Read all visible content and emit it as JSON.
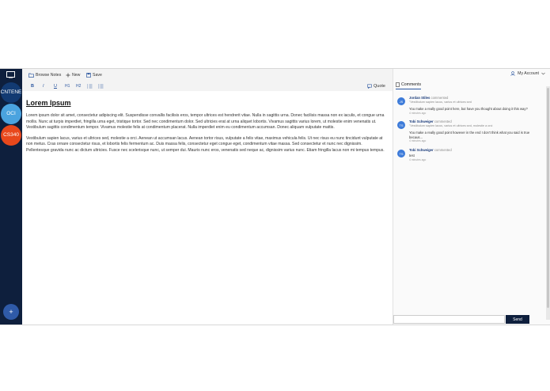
{
  "sidebar": {
    "courses": [
      {
        "label": "CNTENE",
        "color": "#123a72"
      },
      {
        "label": "OCI",
        "color": "#4aa3df"
      },
      {
        "label": "CS340",
        "color": "#e8481c"
      }
    ],
    "add_label": "+"
  },
  "toolbar": {
    "browse_notes": "Browse Notes",
    "new_label": "New",
    "save_label": "Save",
    "format": {
      "bold": "B",
      "italic": "I",
      "underline": "U",
      "h1": "H1",
      "h2": "H2"
    },
    "quote_label": "Quote"
  },
  "document": {
    "title": "Lorem Ipsum",
    "paragraphs": [
      "Lorem ipsum dolor sit amet, consectetur adipiscing elit. Suspendisse convallis facilisis eros, tempor ultrices est hendrerit vitae. Nulla in sagittis urna. Donec facilisis massa non ex iaculis, et congue urna mollis. Nunc at turpis imperdiet, fringilla urna eget, tristique tortor. Sed nec condimentum dolor. Sed ultricies erat at urna aliquet lobortis. Vivamus sagittis varius lorem, ut molestie enim venenatis ut. Vestibulum sagittis condimentum tempor. Vivamus molestie felis at condimentum placerat. Nulla imperdiet enim eu condimentum accumsan. Donec aliquam vulputate mattis.",
      "Vestibulum sapien lacus, varius et ultrices sed, molestie a orci. Aenean ut accumsan lacus. Aenean tortor risus, vulputate a felis vitae, maximus vehicula felis. Ut nec risus eu nunc tincidunt vulputate at non metus. Cras ornare consectetur risus, et lobortis felis fermentum ac. Duis massa felis, consectetur eget congue eget, condimentum vitae massa. Sed consectetur et nunc nec dignissim. Pellentesque gravida nunc ac dictum ultricies. Fusce nec scelerisque nunc, ut semper dui. Mauris nunc eros, venenatis sed neque ac, dignissim varius nunc. Etiam fringilla lacus non mi tempus tempus."
    ]
  },
  "account": {
    "label": "My Account"
  },
  "comments": {
    "tab_label": "Comments",
    "items": [
      {
        "initials": "JS",
        "author": "Jordan Stiles",
        "action": "commented",
        "quote": "\"Vestibulum sapien lacus, varius et ultrices sed",
        "text": "You make a really good point here, but have you thought about doing it this way?",
        "time": "4 minutes ago"
      },
      {
        "initials": "TS",
        "author": "Tobi Schweiger",
        "action": "commented",
        "quote": "\"Vestibulum sapien lacus, varius et ultrices sed, molestie a orci",
        "text": "You make a really good point however in the end I don't think what you said is true becaus...",
        "time": "4 minutes ago"
      },
      {
        "initials": "TS",
        "author": "Tobi Schweiger",
        "action": "commented",
        "quote": "",
        "text": "test",
        "time": "4 minutes ago"
      }
    ],
    "input_placeholder": "",
    "send_label": "Send"
  },
  "colors": {
    "rail": "#0e1f3d",
    "accent": "#2c57a0",
    "avatar": "#3d7bd9"
  }
}
